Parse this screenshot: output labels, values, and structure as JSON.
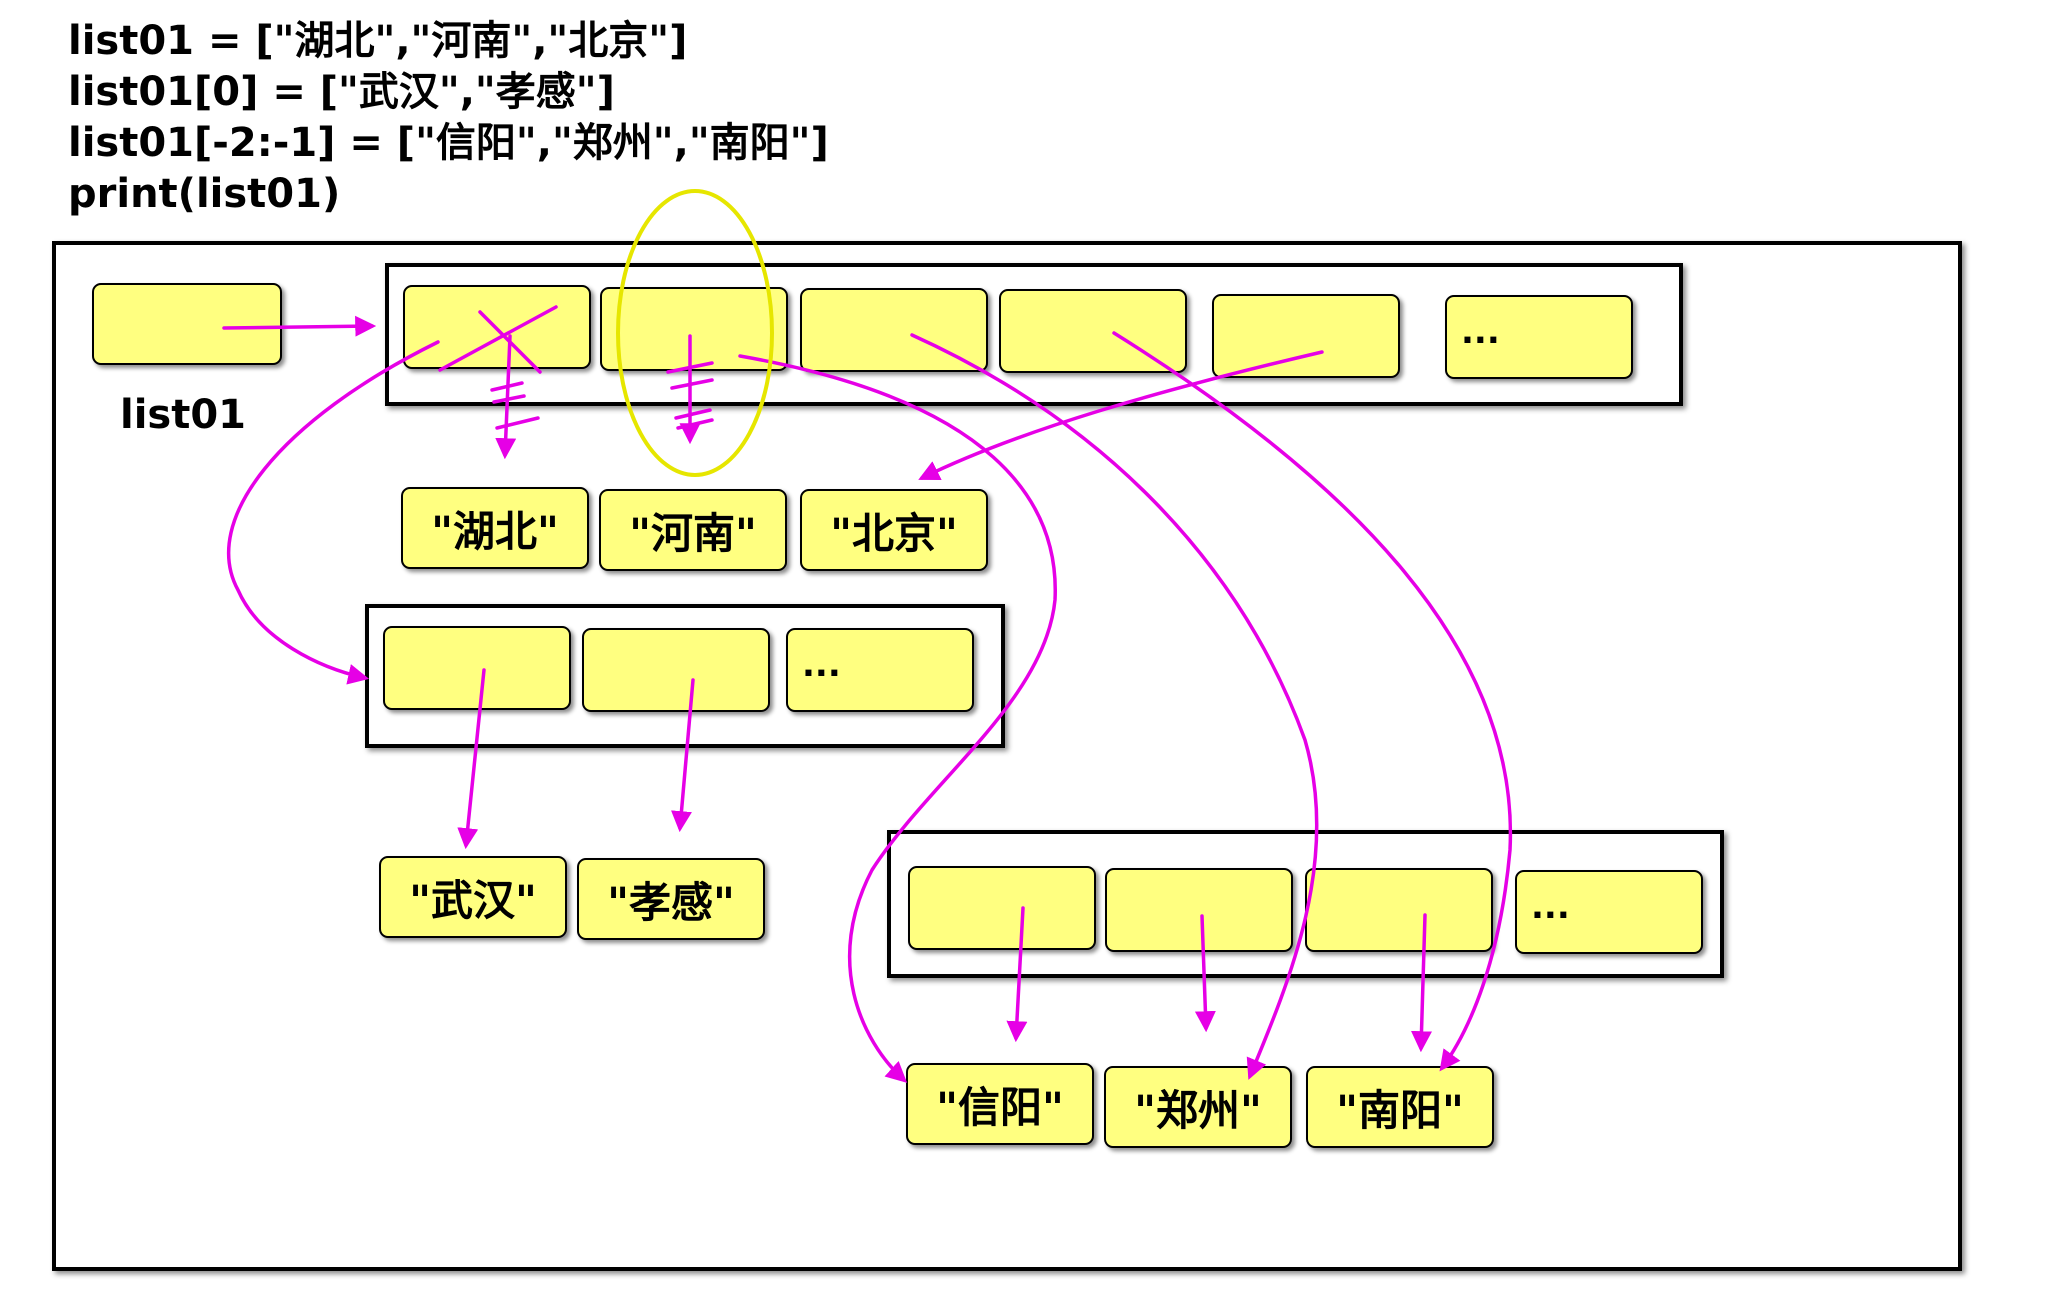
{
  "code": {
    "lines": [
      "list01 = [\"湖北\",\"河南\",\"北京\"]",
      "list01[0] = [\"武汉\",\"孝感\"]",
      "list01[-2:-1] = [\"信阳\",\"郑州\",\"南阳\"]",
      "print(list01)"
    ]
  },
  "diagram": {
    "variable_label": "list01",
    "ellipsis": "...",
    "strings": {
      "s_hubei": "\"湖北\"",
      "s_henan": "\"河南\"",
      "s_beijing": "\"北京\"",
      "s_wuhan": "\"武汉\"",
      "s_xiaogan": "\"孝感\"",
      "s_xinyang": "\"信阳\"",
      "s_zhengzhou": "\"郑州\"",
      "s_nanyang": "\"南阳\""
    }
  },
  "colors": {
    "cell_fill": "#ffff80",
    "arrow": "#e600e6",
    "highlight_ellipse": "#e6e600",
    "outline": "#000000"
  }
}
